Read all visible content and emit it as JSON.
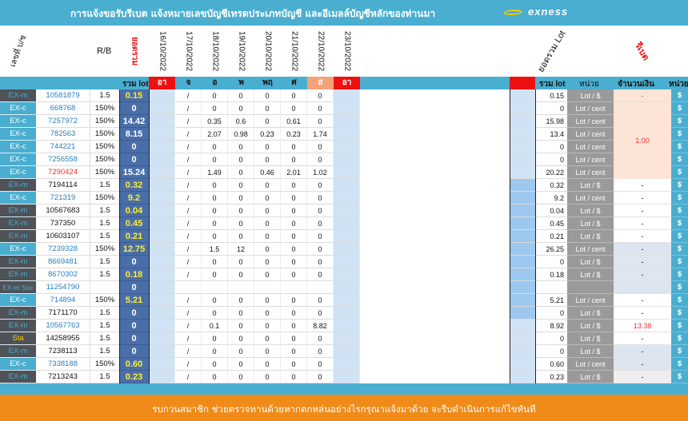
{
  "header": {
    "title": "การแจ้งขอรับรีเบต  แจ้งหมายเลขบัญชีเทรดประเภทบัญชี  และอีเมลล์บัญชีหลักของท่านมา",
    "logo_text": "exness"
  },
  "column_headers": {
    "type": "เลขที่ บ/ช",
    "rb": "R/B",
    "lot": "ยอดรวม",
    "dates": [
      "16/10/2022",
      "17/10/2022",
      "18/10/2022",
      "19/10/2022",
      "20/10/2022",
      "21/10/2022",
      "22/10/2022",
      "23/10/2022"
    ],
    "sum_lot": "ยอดรวม Lot",
    "rebate": "รีเบต"
  },
  "subheader": {
    "sum_lot": "รวม lot",
    "days": [
      "อา",
      "จ",
      "อ",
      "พ",
      "พฤ",
      "ศ",
      "ส",
      "อา"
    ],
    "sum_lot_right": "รวม lot",
    "unit": "หน่วย",
    "amount": "จำนวนเงิน",
    "unit_right": "หน่วย"
  },
  "rows": [
    {
      "type": "EX-m",
      "account": "10581879",
      "rb": "1.5",
      "lot": "0.15",
      "days": [
        "",
        "/",
        "0",
        "0",
        "0",
        "0",
        "0",
        ""
      ],
      "sum": "0.15",
      "unit": "Lot / $",
      "amount": "-",
      "dollar": "$"
    },
    {
      "type": "EX-c",
      "account": "668768",
      "rb": "150%",
      "lot": "0",
      "days": [
        "",
        "/",
        "0",
        "0",
        "0",
        "0",
        "0",
        ""
      ],
      "sum": "0",
      "unit": "Lot / cent",
      "amount": "",
      "dollar": "$"
    },
    {
      "type": "EX-c",
      "account": "7257972",
      "rb": "150%",
      "lot": "14.42",
      "days": [
        "",
        "/",
        "0.35",
        "0.6",
        "0",
        "0.61",
        "0",
        ""
      ],
      "sum": "15.98",
      "unit": "Lot / cent",
      "amount": "",
      "dollar": "$"
    },
    {
      "type": "EX-c",
      "account": "782563",
      "rb": "150%",
      "lot": "8.15",
      "days": [
        "",
        "/",
        "2.07",
        "0.98",
        "0.23",
        "0.23",
        "1.74",
        ""
      ],
      "sum": "13.4",
      "unit": "Lot / cent",
      "amount": "1.00",
      "dollar": "$"
    },
    {
      "type": "EX-c",
      "account": "744221",
      "rb": "150%",
      "lot": "0",
      "days": [
        "",
        "/",
        "0",
        "0",
        "0",
        "0",
        "0",
        ""
      ],
      "sum": "0",
      "unit": "Lot / cent",
      "amount": "",
      "dollar": "$"
    },
    {
      "type": "EX-c",
      "account": "7256558",
      "rb": "150%",
      "lot": "0",
      "days": [
        "",
        "/",
        "0",
        "0",
        "0",
        "0",
        "0",
        ""
      ],
      "sum": "0",
      "unit": "Lot / cent",
      "amount": "",
      "dollar": "$"
    },
    {
      "type": "EX-c",
      "account": "7290424",
      "rb": "150%",
      "lot": "15.24",
      "days": [
        "",
        "/",
        "1.49",
        "0",
        "0.46",
        "2.01",
        "1.02",
        ""
      ],
      "sum": "20.22",
      "unit": "Lot / cent",
      "amount": "",
      "dollar": "$"
    },
    {
      "type": "EX-m",
      "account": "7194114",
      "rb": "1.5",
      "lot": "0.32",
      "days": [
        "",
        "/",
        "0",
        "0",
        "0",
        "0",
        "0",
        ""
      ],
      "sum": "0.32",
      "unit": "Lot / $",
      "amount": "-",
      "dollar": "$"
    },
    {
      "type": "EX-c",
      "account": "721319",
      "rb": "150%",
      "lot": "9.2",
      "days": [
        "",
        "/",
        "0",
        "0",
        "0",
        "0",
        "0",
        ""
      ],
      "sum": "9.2",
      "unit": "Lot / cent",
      "amount": "-",
      "dollar": "$"
    },
    {
      "type": "EX-m",
      "account": "10567683",
      "rb": "1.5",
      "lot": "0.04",
      "days": [
        "",
        "/",
        "0",
        "0",
        "0",
        "0",
        "0",
        ""
      ],
      "sum": "0.04",
      "unit": "Lot / $",
      "amount": "-",
      "dollar": "$"
    },
    {
      "type": "EX-m",
      "account": "737350",
      "rb": "1.5",
      "lot": "0.45",
      "days": [
        "",
        "/",
        "0",
        "0",
        "0",
        "0",
        "0",
        ""
      ],
      "sum": "0.45",
      "unit": "Lot / $",
      "amount": "-",
      "dollar": "$"
    },
    {
      "type": "EX-m",
      "account": "10603107",
      "rb": "1.5",
      "lot": "0.21",
      "days": [
        "",
        "/",
        "0",
        "0",
        "0",
        "0",
        "0",
        ""
      ],
      "sum": "0.21",
      "unit": "Lot / $",
      "amount": "-",
      "dollar": "$"
    },
    {
      "type": "EX-c",
      "account": "7239328",
      "rb": "150%",
      "lot": "12.75",
      "days": [
        "",
        "/",
        "1.5",
        "12",
        "0",
        "0",
        "0",
        ""
      ],
      "sum": "26.25",
      "unit": "Lot / cent",
      "amount": "-",
      "dollar": "$"
    },
    {
      "type": "EX-m",
      "account": "8669481",
      "rb": "1.5",
      "lot": "0",
      "days": [
        "",
        "/",
        "0",
        "0",
        "0",
        "0",
        "0",
        ""
      ],
      "sum": "0",
      "unit": "Lot / $",
      "amount": "-",
      "dollar": "$"
    },
    {
      "type": "EX-m",
      "account": "8670302",
      "rb": "1.5",
      "lot": "0.18",
      "days": [
        "",
        "/",
        "0",
        "0",
        "0",
        "0",
        "0",
        ""
      ],
      "sum": "0.18",
      "unit": "Lot / $",
      "amount": "-",
      "dollar": "$"
    },
    {
      "type": "EX-m Soc",
      "account": "11254790",
      "rb": "",
      "lot": "0",
      "days": [
        "",
        "",
        "",
        "",
        "",
        "",
        "",
        ""
      ],
      "sum": "",
      "unit": "",
      "amount": "",
      "dollar": "$"
    },
    {
      "type": "EX-c",
      "account": "714894",
      "rb": "150%",
      "lot": "5.21",
      "days": [
        "",
        "/",
        "0",
        "0",
        "0",
        "0",
        "0",
        ""
      ],
      "sum": "5.21",
      "unit": "Lot / cent",
      "amount": "-",
      "dollar": "$"
    },
    {
      "type": "EX-m",
      "account": "7171170",
      "rb": "1.5",
      "lot": "0",
      "days": [
        "",
        "/",
        "0",
        "0",
        "0",
        "0",
        "0",
        ""
      ],
      "sum": "0",
      "unit": "Lot / $",
      "amount": "-",
      "dollar": "$"
    },
    {
      "type": "EX-m",
      "account": "10567763",
      "rb": "1.5",
      "lot": "0",
      "days": [
        "",
        "/",
        "0.1",
        "0",
        "0",
        "0",
        "8.82",
        ""
      ],
      "sum": "8.92",
      "unit": "Lot / $",
      "amount": "13.38",
      "dollar": "$"
    },
    {
      "type": "Sta",
      "account": "14258955",
      "rb": "1.5",
      "lot": "0",
      "days": [
        "",
        "/",
        "0",
        "0",
        "0",
        "0",
        "0",
        ""
      ],
      "sum": "0",
      "unit": "Lot / $",
      "amount": "-",
      "dollar": "$"
    },
    {
      "type": "EX-m",
      "account": "7238113",
      "rb": "1.5",
      "lot": "0",
      "days": [
        "",
        "/",
        "0",
        "0",
        "0",
        "0",
        "0",
        ""
      ],
      "sum": "0",
      "unit": "Lot / $",
      "amount": "-",
      "dollar": "$"
    },
    {
      "type": "EX-c",
      "account": "7338188",
      "rb": "150%",
      "lot": "0.60",
      "days": [
        "",
        "/",
        "0",
        "0",
        "0",
        "0",
        "0",
        ""
      ],
      "sum": "0.60",
      "unit": "Lot / cent",
      "amount": "-",
      "dollar": "$"
    },
    {
      "type": "EX-m",
      "account": "7213243",
      "rb": "1.5",
      "lot": "0.23",
      "days": [
        "",
        "/",
        "0",
        "0",
        "0",
        "0",
        "0",
        ""
      ],
      "sum": "0.23",
      "unit": "Lot / $",
      "amount": "-",
      "dollar": "$"
    }
  ],
  "footer": {
    "text": "รบกวนสมาชิก ช่วยตรวจทานด้วยหากตกหล่นอย่างไรกรุณาแจ้งมาด้วย  จะรีบดำเนินการแก้ไขทันที"
  },
  "colors": {
    "header": "#4aaed0",
    "lot_column": "#4a6ea8",
    "lot_yellow": "#ffee33",
    "weekend_highlight": "#f4a27a",
    "red_marker": "#ee1111",
    "footer": "#f08b19"
  }
}
